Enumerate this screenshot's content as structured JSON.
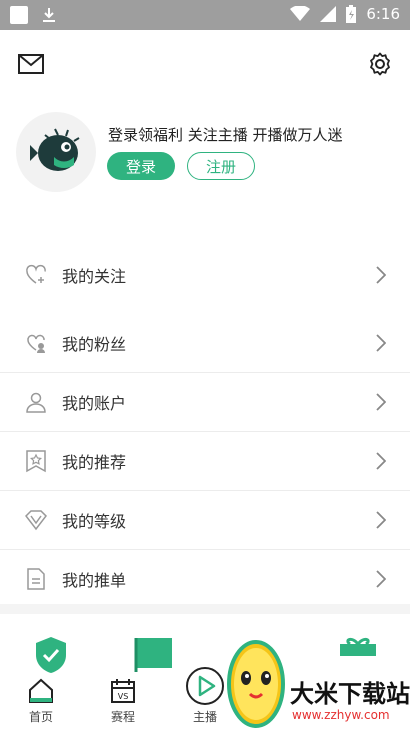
{
  "status_bar": {
    "time": "6:16"
  },
  "profile": {
    "promo_text": "登录领福利 关注主播 开播做万人迷",
    "login_label": "登录",
    "register_label": "注册"
  },
  "menu": {
    "items": [
      {
        "label": "我的关注",
        "icon": "heart-plus-icon"
      },
      {
        "label": "我的粉丝",
        "icon": "heart-people-icon"
      },
      {
        "label": "我的账户",
        "icon": "user-icon"
      },
      {
        "label": "我的推荐",
        "icon": "bookmark-star-icon"
      },
      {
        "label": "我的等级",
        "icon": "diamond-icon"
      },
      {
        "label": "我的推单",
        "icon": "document-icon"
      }
    ]
  },
  "bottom_nav": {
    "items": [
      {
        "label": "首页",
        "icon": "home-icon"
      },
      {
        "label": "赛程",
        "icon": "calendar-vs-icon"
      },
      {
        "label": "主播",
        "icon": "play-circle-icon"
      }
    ]
  },
  "watermark": {
    "title": "大米下载站",
    "url": "www.zzhyw.com"
  },
  "colors": {
    "accent": "#2fb380",
    "status_bar": "#9e9e9e"
  }
}
